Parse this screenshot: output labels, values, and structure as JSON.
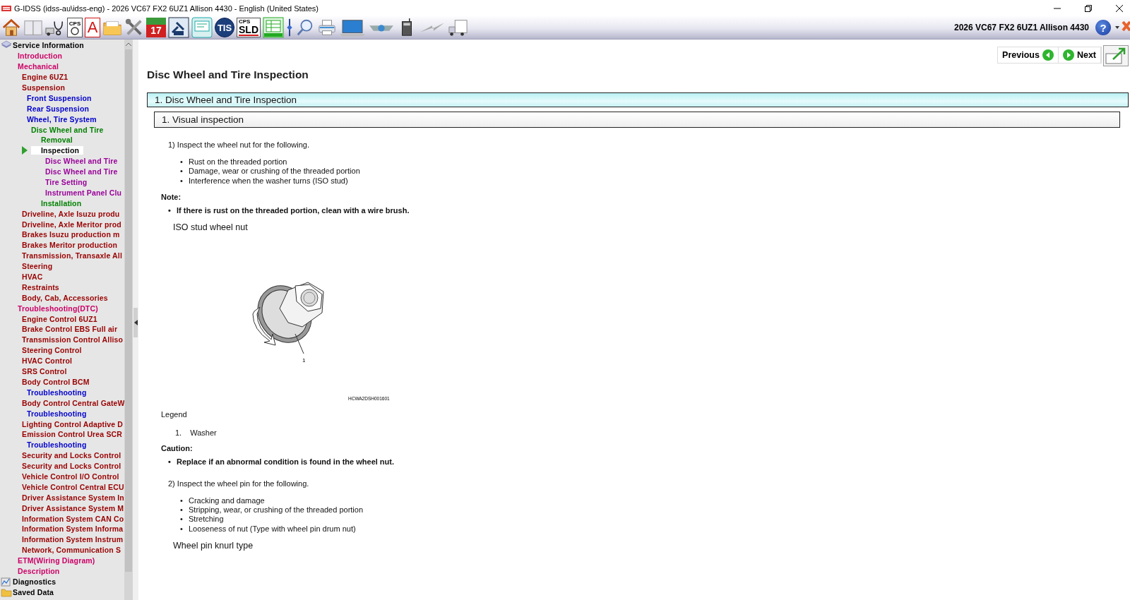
{
  "window": {
    "title": "G-IDSS (idss-au\\idss-eng) - 2026 VC67 FX2 6UZ1 Allison 4430 - English (United States)"
  },
  "toolbar": {
    "tools": [
      {
        "kind": "home"
      },
      {
        "kind": "book"
      },
      {
        "kind": "truck-scope"
      },
      {
        "kind": "cps",
        "label": "CPS"
      },
      {
        "kind": "letter",
        "label": "A"
      },
      {
        "kind": "folder"
      },
      {
        "kind": "tools"
      },
      {
        "kind": "calendar",
        "label": "17"
      },
      {
        "kind": "report"
      },
      {
        "kind": "screen-doc"
      },
      {
        "kind": "badge",
        "label": "TIS"
      },
      {
        "kind": "sld",
        "label": "CPS",
        "sublabel": "SLD"
      },
      {
        "kind": "sheet"
      },
      {
        "kind": "pin"
      },
      {
        "kind": "search"
      },
      {
        "kind": "printer"
      },
      {
        "kind": "laptop"
      },
      {
        "kind": "network"
      },
      {
        "kind": "radio"
      },
      {
        "kind": "bolt"
      },
      {
        "kind": "truck"
      }
    ],
    "vehicle": "2026 VC67 FX2 6UZ1 Allison 4430",
    "help_label": "?"
  },
  "sidebar": {
    "tree": [
      {
        "label": "Service Information",
        "kind": "layers",
        "selected": false,
        "children": [
          {
            "label": "Introduction",
            "selected": false
          },
          {
            "label": "Mechanical",
            "selected": false,
            "children": [
              {
                "label": "Engine 6UZ1",
                "selected": false
              },
              {
                "label": "Suspension",
                "selected": false,
                "children": [
                  {
                    "label": "Front Suspension",
                    "selected": false
                  },
                  {
                    "label": "Rear Suspension",
                    "selected": false
                  },
                  {
                    "label": "Wheel, Tire System",
                    "selected": false,
                    "children": [
                      {
                        "label": "Disc Wheel and Tire",
                        "selected": false,
                        "children": [
                          {
                            "label": "Removal",
                            "selected": false
                          },
                          {
                            "label": "Inspection",
                            "selected": true,
                            "children": [
                              {
                                "label": "Disc Wheel and Tire",
                                "selected": false
                              },
                              {
                                "label": "Disc Wheel and Tire",
                                "selected": false
                              },
                              {
                                "label": "Tire Setting",
                                "selected": false
                              },
                              {
                                "label": "Instrument Panel Clu",
                                "selected": false
                              }
                            ]
                          },
                          {
                            "label": "Installation",
                            "selected": false
                          }
                        ]
                      }
                    ]
                  }
                ]
              },
              {
                "label": "Driveline, Axle Isuzu produ",
                "selected": false
              },
              {
                "label": "Driveline, Axle Meritor prod",
                "selected": false
              },
              {
                "label": "Brakes Isuzu production m",
                "selected": false
              },
              {
                "label": "Brakes Meritor production",
                "selected": false
              },
              {
                "label": "Transmission, Transaxle All",
                "selected": false
              },
              {
                "label": "Steering",
                "selected": false
              },
              {
                "label": "HVAC",
                "selected": false
              },
              {
                "label": "Restraints",
                "selected": false
              },
              {
                "label": "Body, Cab, Accessories",
                "selected": false
              }
            ]
          },
          {
            "label": "Troubleshooting(DTC)",
            "selected": false,
            "children": [
              {
                "label": "Engine Control 6UZ1",
                "selected": false
              },
              {
                "label": "Brake Control EBS Full air",
                "selected": false
              },
              {
                "label": "Transmission Control Alliso",
                "selected": false
              },
              {
                "label": "Steering Control",
                "selected": false
              },
              {
                "label": "HVAC Control",
                "selected": false
              },
              {
                "label": "SRS Control",
                "selected": false
              },
              {
                "label": "Body Control BCM",
                "selected": false,
                "children": [
                  {
                    "label": "Troubleshooting",
                    "selected": false
                  }
                ]
              },
              {
                "label": "Body Control Central GateW",
                "selected": false,
                "children": [
                  {
                    "label": "Troubleshooting",
                    "selected": false
                  }
                ]
              },
              {
                "label": "Lighting Control Adaptive D",
                "selected": false
              },
              {
                "label": "Emission Control Urea SCR",
                "selected": false,
                "children": [
                  {
                    "label": "Troubleshooting",
                    "selected": false
                  }
                ]
              },
              {
                "label": "Security and Locks Control",
                "selected": false
              },
              {
                "label": "Security and Locks Control",
                "selected": false
              },
              {
                "label": "Vehicle Control I/O Control",
                "selected": false
              },
              {
                "label": "Vehicle Control Central ECU",
                "selected": false
              },
              {
                "label": "Driver Assistance System In",
                "selected": false
              },
              {
                "label": "Driver Assistance System M",
                "selected": false
              },
              {
                "label": "Information System CAN Co",
                "selected": false
              },
              {
                "label": "Information System Informa",
                "selected": false
              },
              {
                "label": "Information System Instrum",
                "selected": false
              },
              {
                "label": "Network, Communication S",
                "selected": false
              }
            ]
          },
          {
            "label": "ETM(Wiring Diagram)",
            "selected": false
          },
          {
            "label": "Description",
            "selected": false
          }
        ]
      },
      {
        "label": "Diagnostics",
        "kind": "scope",
        "selected": false
      },
      {
        "label": "Saved Data",
        "kind": "folder",
        "selected": false
      }
    ]
  },
  "content": {
    "previous": "Previous",
    "next": "Next",
    "title": "Disc Wheel and Tire Inspection",
    "section_title": "1. Disc Wheel and Tire Inspection",
    "subsection_title": "1. Visual inspection",
    "blocks": [
      {
        "kind": "step",
        "text": "1) Inspect the wheel nut for the following."
      },
      {
        "kind": "list",
        "marker": "•",
        "items": [
          "Rust on the threaded portion",
          "Damage, wear or crushing of the threaded portion",
          "Interference when the washer turns (ISO stud)"
        ]
      },
      {
        "kind": "heading",
        "text": "Note:"
      },
      {
        "kind": "bold_list",
        "marker": "•",
        "items": [
          "If there is rust on the threaded portion, clean with a wire brush."
        ]
      },
      {
        "kind": "caption",
        "text": "ISO stud wheel nut"
      },
      {
        "kind": "figure",
        "callout": "1",
        "code": "HCWA2DSH001601"
      },
      {
        "kind": "label",
        "text": "Legend"
      },
      {
        "kind": "legend",
        "items": [
          {
            "number": "1.",
            "text": "Washer"
          }
        ]
      },
      {
        "kind": "heading",
        "text": "Caution:"
      },
      {
        "kind": "bold_list",
        "marker": "•",
        "items": [
          "Replace if an abnormal condition is found in the wheel nut."
        ]
      },
      {
        "kind": "step",
        "text": "2) Inspect the wheel pin for the following."
      },
      {
        "kind": "list",
        "marker": "•",
        "items": [
          "Cracking and damage",
          "Stripping, wear, or crushing of the threaded portion",
          "Stretching",
          "Looseness of nut (Type with wheel pin drum nut)"
        ]
      },
      {
        "kind": "caption",
        "text": "Wheel pin knurl type"
      }
    ]
  }
}
